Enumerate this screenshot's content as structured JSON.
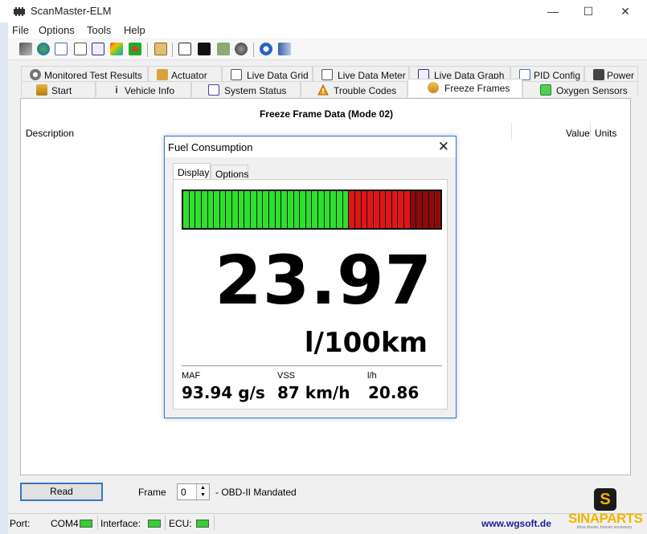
{
  "window": {
    "title": "ScanMaster-ELM",
    "minimize": "—",
    "maximize": "☐",
    "close": "✕"
  },
  "menu": [
    "File",
    "Options",
    "Tools",
    "Help"
  ],
  "tabs_row1": [
    "Monitored Test Results",
    "Actuator",
    "Live Data Grid",
    "Live Data Meter",
    "Live Data Graph",
    "PID Config",
    "Power"
  ],
  "tabs_row2": [
    "Start",
    "Vehicle Info",
    "System Status",
    "Trouble Codes",
    "Freeze Frames",
    "Oxygen Sensors"
  ],
  "active_tab": "Freeze Frames",
  "freeze_frame": {
    "title": "Freeze Frame Data (Mode 02)",
    "col_description": "Description",
    "col_value": "Value",
    "col_units": "Units"
  },
  "dialog": {
    "title": "Fuel Consumption",
    "close": "✕",
    "tabs": [
      "Display",
      "Options"
    ],
    "active_tab": "Display",
    "bar": {
      "segments_total": 42,
      "green_segments": 27,
      "red_segments": 10,
      "darkred_segments": 5,
      "colors": {
        "green": "#2ee02e",
        "red": "#e01616",
        "darkred": "#8e0a0a"
      }
    },
    "value": "23.97",
    "units": "l/100km",
    "maf_label": "MAF",
    "maf_value": "93.94 g/s",
    "vss_label": "VSS",
    "vss_value": "87 km/h",
    "lh_label": "l/h",
    "lh_value": "20.86"
  },
  "controls": {
    "read_button": "Read",
    "frame_label": "Frame",
    "frame_value": "0",
    "obd_label": "- OBD-II Mandated"
  },
  "status": {
    "port_label": "Port:",
    "port_value": "COM4",
    "interface_label": "Interface:",
    "ecu_label": "ECU:",
    "link": "www.wgsoft.de"
  },
  "logo": {
    "badge": "S",
    "name": "SINAPARTS",
    "tagline": "drive dream, forever accessory"
  }
}
